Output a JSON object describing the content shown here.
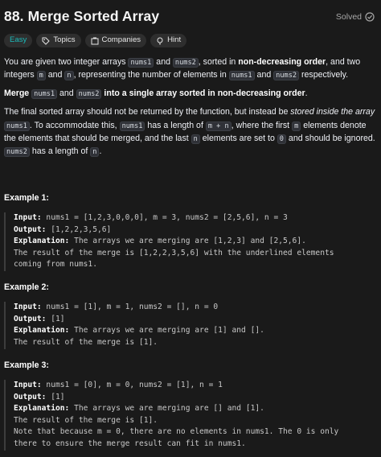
{
  "header": {
    "title": "88. Merge Sorted Array",
    "solved_label": "Solved"
  },
  "tags": [
    {
      "label": "Easy"
    },
    {
      "label": "Topics",
      "icon": "tag-icon"
    },
    {
      "label": "Companies",
      "icon": "building-icon"
    },
    {
      "label": "Hint",
      "icon": "lightbulb-icon"
    }
  ],
  "description": {
    "p1": {
      "t1": "You are given two integer arrays ",
      "c1": "nums1",
      "t2": " and ",
      "c2": "nums2",
      "t3": ", sorted in ",
      "b1": "non-decreasing order",
      "t4": ", and two integers ",
      "c3": "m",
      "t5": " and ",
      "c4": "n",
      "t6": ", representing the number of elements in ",
      "c5": "nums1",
      "t7": " and ",
      "c6": "nums2",
      "t8": " respectively."
    },
    "p2": {
      "b1": "Merge",
      "c1": "nums1",
      "t1": " and ",
      "c2": "nums2",
      "b2": " into a single array sorted in ",
      "b3": "non-decreasing order",
      "t2": "."
    },
    "p3": {
      "t1": "The final sorted array should not be returned by the function, but instead be ",
      "i1": "stored inside the array",
      "c1": "nums1",
      "t2": ". To accommodate this, ",
      "c2": "nums1",
      "t3": " has a length of ",
      "c3": "m + n",
      "t4": ", where the first ",
      "c4": "m",
      "t5": " elements denote the elements that should be merged, and the last ",
      "c5": "n",
      "t6": " elements are set to ",
      "c6": "0",
      "t7": " and should be ignored. ",
      "c7": "nums2",
      "t8": " has a length of ",
      "c8": "n",
      "t9": "."
    }
  },
  "examples": [
    {
      "title": "Example 1:",
      "input_label": "Input:",
      "input": " nums1 = [1,2,3,0,0,0], m = 3, nums2 = [2,5,6], n = 3",
      "output_label": "Output:",
      "output": " [1,2,2,3,5,6]",
      "explanation_label": "Explanation:",
      "explanation": " The arrays we are merging are [1,2,3] and [2,5,6].",
      "line2": "The result of the merge is [1,2,2,3,5,6] with the underlined elements",
      "line3": "coming from nums1."
    },
    {
      "title": "Example 2:",
      "input_label": "Input:",
      "input": " nums1 = [1], m = 1, nums2 = [], n = 0",
      "output_label": "Output:",
      "output": " [1]",
      "explanation_label": "Explanation:",
      "explanation": " The arrays we are merging are [1] and [].",
      "line2": "The result of the merge is [1]."
    },
    {
      "title": "Example 3:",
      "input_label": "Input:",
      "input": " nums1 = [0], m = 0, nums2 = [1], n = 1",
      "output_label": "Output:",
      "output": " [1]",
      "explanation_label": "Explanation:",
      "explanation": " The arrays we are merging are [] and [1].",
      "line2": "The result of the merge is [1].",
      "line3": "Note that because m = 0, there are no elements in nums1. The 0 is only",
      "line4": "there to ensure the merge result can fit in nums1."
    }
  ],
  "colors": {
    "easy": "#1cbaba",
    "background": "#1a1a1a",
    "text": "#eff1f6"
  }
}
